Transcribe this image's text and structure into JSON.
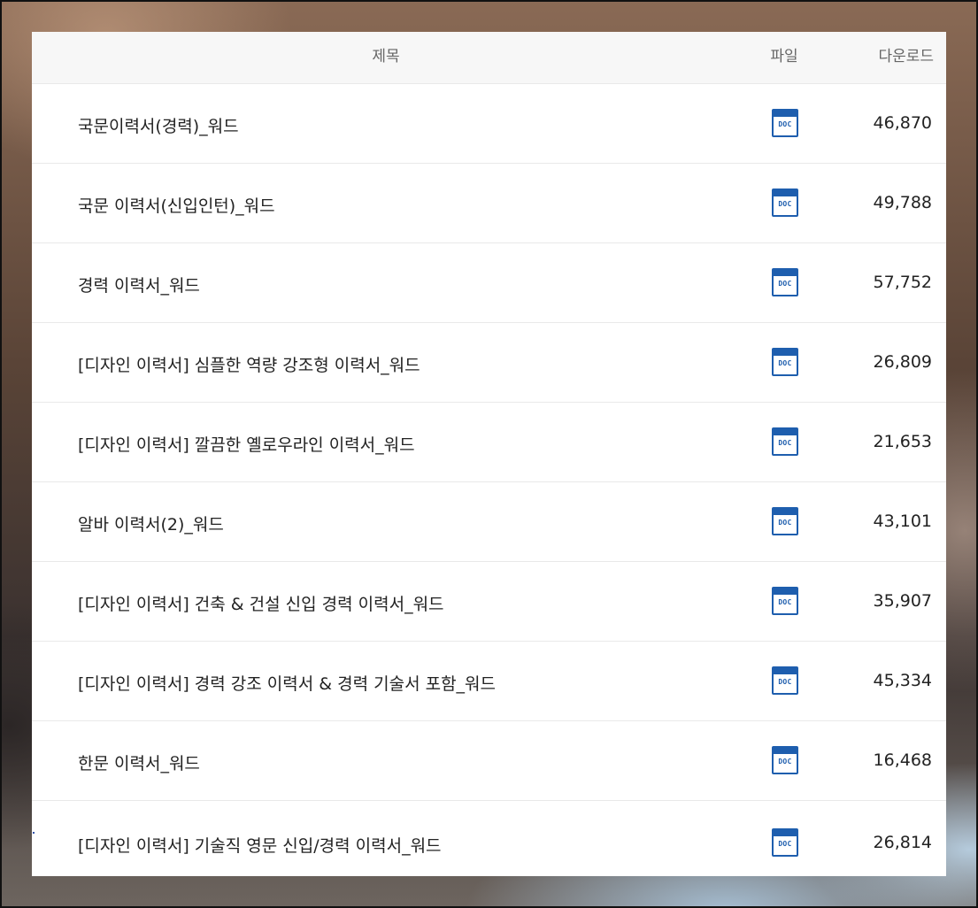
{
  "table": {
    "headers": {
      "title": "제목",
      "file": "파일",
      "downloads": "다운로드"
    },
    "file_icon_label": "DOC",
    "rows": [
      {
        "title": "국문이력서(경력)_워드",
        "downloads": "46,870"
      },
      {
        "title": "국문 이력서(신입인턴)_워드",
        "downloads": "49,788"
      },
      {
        "title": "경력 이력서_워드",
        "downloads": "57,752"
      },
      {
        "title": "[디자인 이력서] 심플한 역량 강조형 이력서_워드",
        "downloads": "26,809"
      },
      {
        "title": "[디자인 이력서] 깔끔한 옐로우라인 이력서_워드",
        "downloads": "21,653"
      },
      {
        "title": "알바 이력서(2)_워드",
        "downloads": "43,101"
      },
      {
        "title": "[디자인 이력서] 건축 & 건설 신입 경력 이력서_워드",
        "downloads": "35,907"
      },
      {
        "title": "[디자인 이력서] 경력 강조 이력서 & 경력 기술서 포함_워드",
        "downloads": "45,334"
      },
      {
        "title": "한문 이력서_워드",
        "downloads": "16,468"
      },
      {
        "title": "[디자인 이력서] 기술직 영문 신입/경력 이력서_워드",
        "downloads": "26,814"
      }
    ]
  },
  "colors": {
    "doc_icon": "#1e5eae",
    "header_bg": "#f7f7f7"
  }
}
